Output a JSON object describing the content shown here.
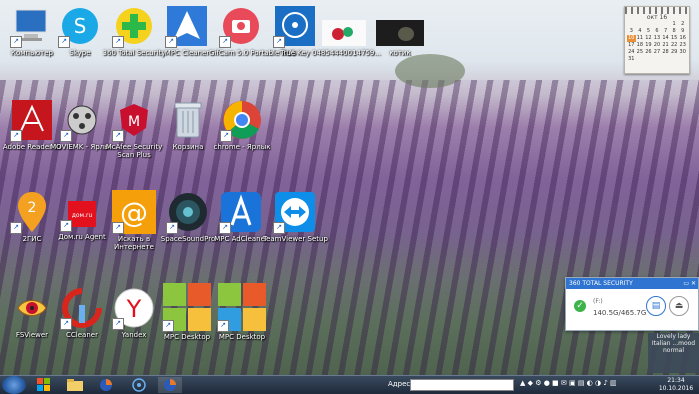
{
  "desktop_icons": [
    {
      "id": "computer",
      "label": "Компьютер"
    },
    {
      "id": "skype",
      "label": "Skype"
    },
    {
      "id": "360-total-security",
      "label": "360 Total Security"
    },
    {
      "id": "mpc-cleaner",
      "label": "MPC Cleaner"
    },
    {
      "id": "gifcam",
      "label": "GifCam 5.0 Portable RUS"
    },
    {
      "id": "truekey",
      "label": "True Key"
    },
    {
      "id": "image-number",
      "label": "04854440014759..."
    },
    {
      "id": "kotik",
      "label": "котик"
    },
    {
      "id": "adobe-reader",
      "label": "Adobe Reader XI"
    },
    {
      "id": "moviemk",
      "label": "MOVIEMK - Ярлык"
    },
    {
      "id": "mcafee",
      "label": "McAfee Security Scan Plus"
    },
    {
      "id": "recycle-bin",
      "label": "Корзина"
    },
    {
      "id": "chrome",
      "label": "chrome - Ярлык"
    },
    {
      "id": "2gis",
      "label": "2ГИС"
    },
    {
      "id": "dom-ru",
      "label": "Дом.ru Agent"
    },
    {
      "id": "mail-ru",
      "label": "Искать в Интернете"
    },
    {
      "id": "spacesoundpro",
      "label": "SpaceSoundPro"
    },
    {
      "id": "mpc-adcleaner",
      "label": "MPC AdCleaner"
    },
    {
      "id": "teamviewer",
      "label": "TeamViewer Setup"
    },
    {
      "id": "fsviewer",
      "label": "FSViewer"
    },
    {
      "id": "ccleaner",
      "label": "CCleaner"
    },
    {
      "id": "yandex",
      "label": "Yandex"
    },
    {
      "id": "mpc-desktop-1",
      "label": "MPC Desktop"
    },
    {
      "id": "mpc-desktop-2",
      "label": "MPC Desktop"
    }
  ],
  "calendar": {
    "month": "окт 16",
    "days": [
      "",
      "",
      "",
      "",
      "",
      "1",
      "2",
      "3",
      "4",
      "5",
      "6",
      "7",
      "8",
      "9",
      "10",
      "11",
      "12",
      "13",
      "14",
      "15",
      "16",
      "17",
      "18",
      "19",
      "20",
      "21",
      "22",
      "23",
      "24",
      "25",
      "26",
      "27",
      "28",
      "29",
      "30",
      "31"
    ],
    "today": "10"
  },
  "security_widget": {
    "title": "360 TOTAL SECURITY",
    "drive": "(F:)",
    "size": "140.5G/465.7G"
  },
  "corner_note": {
    "text": "Lovely lady Italian ...mood normal"
  },
  "taskbar": {
    "address_label": "Адрес",
    "address_value": "",
    "time": "21:34",
    "date": "10.10.2016"
  }
}
